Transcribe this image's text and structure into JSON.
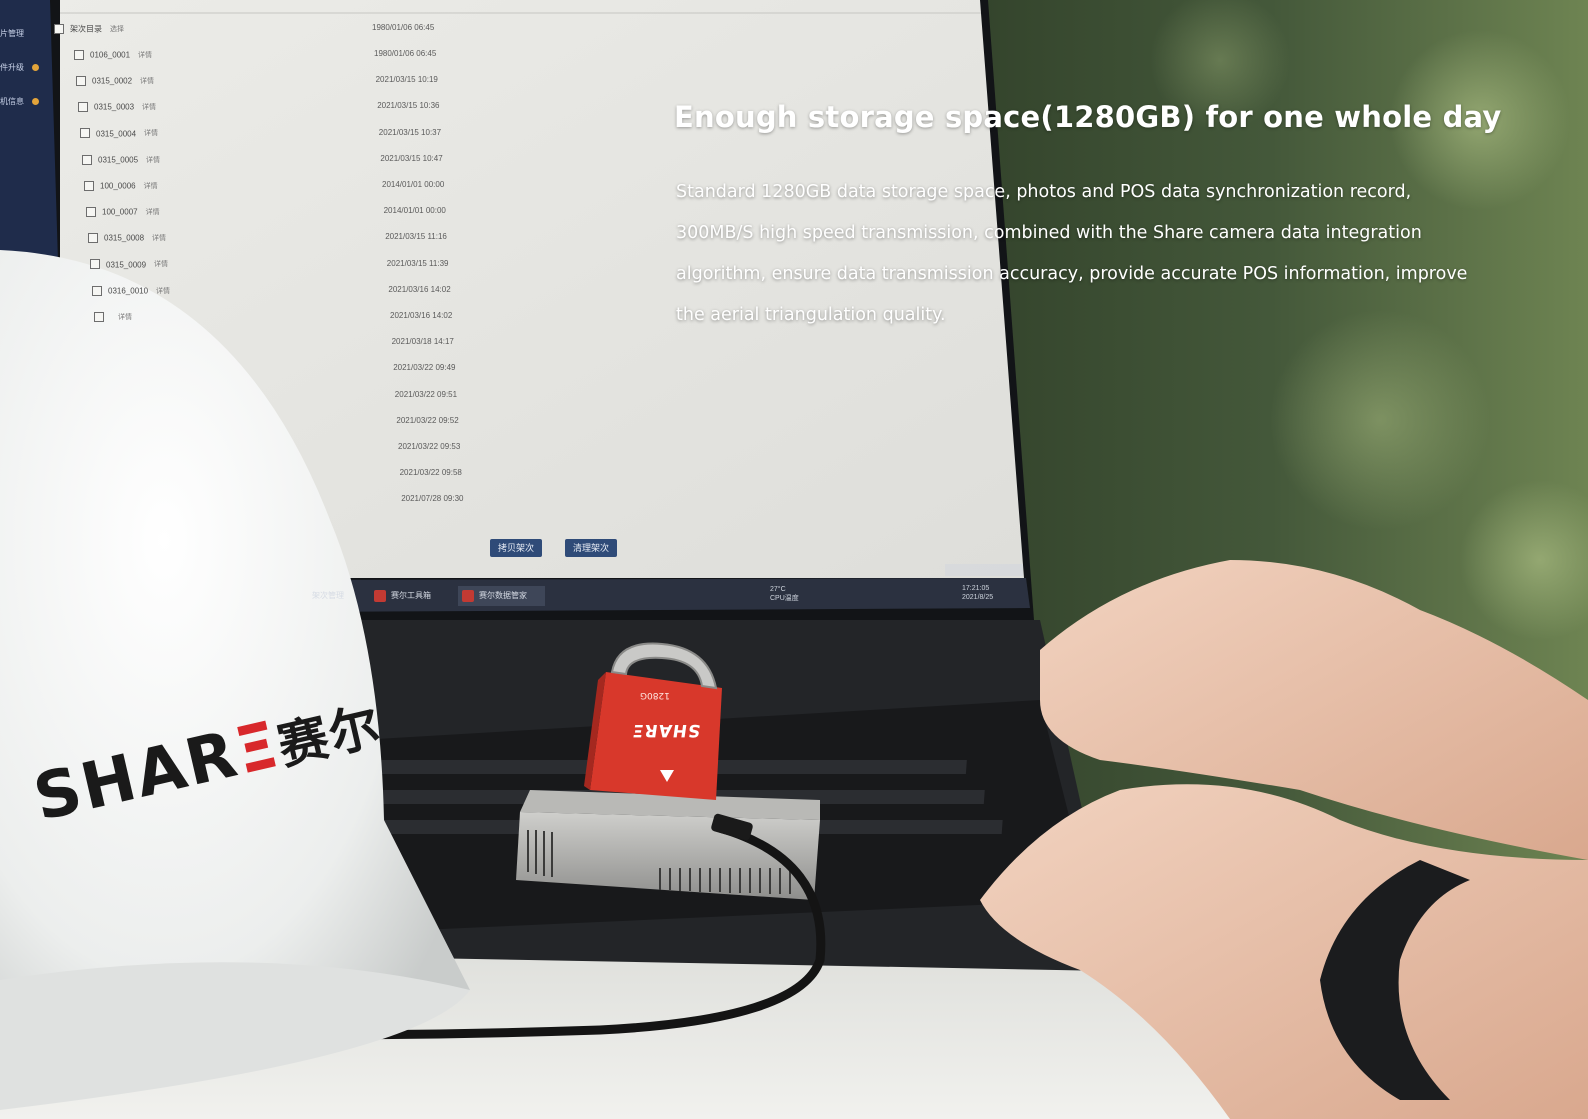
{
  "headline": "Enough storage space(1280GB) for one whole day",
  "body": "Standard 1280GB data storage space, photos and POS data synchronization record, 300MB/S high speed transmission, combined with the Share camera data integration algorithm, ensure data transmission accuracy, provide accurate POS information, improve the aerial triangulation quality.",
  "sidebar": {
    "items": [
      {
        "label": "片管理",
        "badge": false
      },
      {
        "label": "件升级",
        "badge": true
      },
      {
        "label": "机信息",
        "badge": true
      }
    ]
  },
  "file_list": {
    "root": {
      "name": "架次目录",
      "tag": "选择",
      "date": "1980/01/06 06:45"
    },
    "rows": [
      {
        "name": "0106_0001",
        "tag": "详情",
        "date": "1980/01/06 06:45"
      },
      {
        "name": "0315_0002",
        "tag": "详情",
        "date": "2021/03/15 10:19"
      },
      {
        "name": "0315_0003",
        "tag": "详情",
        "date": "2021/03/15 10:36"
      },
      {
        "name": "0315_0004",
        "tag": "详情",
        "date": "2021/03/15 10:37"
      },
      {
        "name": "0315_0005",
        "tag": "详情",
        "date": "2021/03/15 10:47"
      },
      {
        "name": "100_0006",
        "tag": "详情",
        "date": "2014/01/01 00:00"
      },
      {
        "name": "100_0007",
        "tag": "详情",
        "date": "2014/01/01 00:00"
      },
      {
        "name": "0315_0008",
        "tag": "详情",
        "date": "2021/03/15 11:16"
      },
      {
        "name": "0315_0009",
        "tag": "详情",
        "date": "2021/03/15 11:39"
      },
      {
        "name": "0316_0010",
        "tag": "详情",
        "date": "2021/03/16 14:02"
      },
      {
        "name": "",
        "tag": "详情",
        "date": "2021/03/16 14:02"
      }
    ],
    "extra_dates": [
      "2021/03/18 14:17",
      "2021/03/22 09:49",
      "2021/03/22 09:51",
      "2021/03/22 09:52",
      "2021/03/22 09:53",
      "2021/03/22 09:58",
      "2021/07/28 09:30"
    ]
  },
  "buttons": {
    "copy": "拷贝架次",
    "clear": "清理架次"
  },
  "taskbar": {
    "items": [
      "架次管理",
      "赛尔工具箱",
      "赛尔数据管家"
    ],
    "temp": "27°C",
    "temp_label": "CPU温度",
    "time": "17:21:05",
    "date": "2021/8/25"
  },
  "helmet": {
    "brand": "SHAR",
    "accent": "Ξ",
    "cjk": "赛尔"
  },
  "card": {
    "brand": "SHAR",
    "accent": "Ξ",
    "capacity": "1280G"
  },
  "colors": {
    "screen_bg": "#e8e8e3",
    "button": "#2f4b78",
    "card_red": "#d8382b",
    "accent_red": "#d8282b"
  }
}
